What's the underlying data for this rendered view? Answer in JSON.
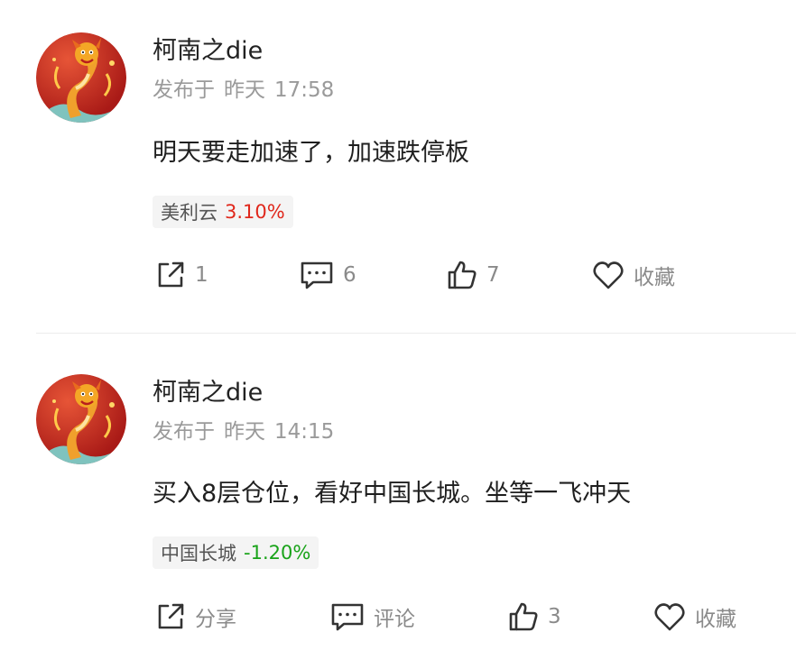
{
  "posts": [
    {
      "author": "柯南之die",
      "published_label": "发布于",
      "time_day": "昨天",
      "time": "17:58",
      "content": "明天要走加速了，加速跌停板",
      "stock": {
        "name": "美利云",
        "change": "3.10%",
        "direction": "up",
        "color": "#e0281c"
      },
      "actions": {
        "share": "1",
        "comment": "6",
        "like": "7",
        "favorite": "收藏"
      }
    },
    {
      "author": "柯南之die",
      "published_label": "发布于",
      "time_day": "昨天",
      "time": "14:15",
      "content": "买入8层仓位，看好中国长城。坐等一飞冲天",
      "stock": {
        "name": "中国长城",
        "change": "-1.20%",
        "direction": "down",
        "color": "#19a319"
      },
      "actions": {
        "share": "分享",
        "comment": "评论",
        "like": "3",
        "favorite": "收藏"
      }
    }
  ],
  "icons": {
    "avatar": "dragon-avatar-icon",
    "share": "share-icon",
    "comment": "comment-icon",
    "like": "thumbs-up-icon",
    "favorite": "heart-icon"
  }
}
